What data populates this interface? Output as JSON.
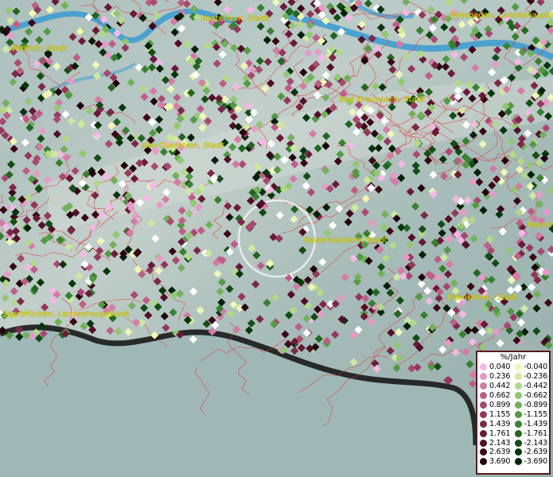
{
  "places": [
    {
      "name": "Kastellaun, Stadt"
    },
    {
      "name": "Wiesbaden, Landeshauptstadt"
    },
    {
      "name": "Wittlich, Stadt"
    },
    {
      "name": "Bad Kreuznach, Stadt"
    },
    {
      "name": "Idar-Oberstein, Stadt"
    },
    {
      "name": "Kaiserslautern, Stadt"
    },
    {
      "name": "Mannh"
    },
    {
      "name": "Saarbrücken, Landeshauptstadt"
    },
    {
      "name": "Edenkoben, Stadt"
    }
  ],
  "legend": {
    "title": "%/Jahr",
    "positive": [
      {
        "label": "0.040",
        "color": "#f4b8e6"
      },
      {
        "label": "0.236",
        "color": "#e69ac8"
      },
      {
        "label": "0.442",
        "color": "#d27ca6"
      },
      {
        "label": "0.662",
        "color": "#bc5f88"
      },
      {
        "label": "0.899",
        "color": "#a64a70"
      },
      {
        "label": "1.155",
        "color": "#93385c"
      },
      {
        "label": "1.439",
        "color": "#7d2848"
      },
      {
        "label": "1.761",
        "color": "#681a36"
      },
      {
        "label": "2.143",
        "color": "#520f26"
      },
      {
        "label": "2.639",
        "color": "#3a0717"
      },
      {
        "label": "3.690",
        "color": "#22030b"
      }
    ],
    "negative": [
      {
        "label": "-0.040",
        "color": "#eef7b8"
      },
      {
        "label": "-0.236",
        "color": "#cfe8a0"
      },
      {
        "label": "-0.442",
        "color": "#b2d98a"
      },
      {
        "label": "-0.662",
        "color": "#93c675"
      },
      {
        "label": "-0.899",
        "color": "#72b05d"
      },
      {
        "label": "-1.155",
        "color": "#549945"
      },
      {
        "label": "-1.439",
        "color": "#3a8032"
      },
      {
        "label": "-1.761",
        "color": "#236622"
      },
      {
        "label": "-2.143",
        "color": "#134d16"
      },
      {
        "label": "-2.639",
        "color": "#08360c"
      },
      {
        "label": "-3.690",
        "color": "#032106"
      }
    ]
  },
  "colors": {
    "water": "#3a9ad0",
    "boundary": "#e0343a",
    "place_label": "#e8e000",
    "point_neutral": "#ffffff"
  }
}
